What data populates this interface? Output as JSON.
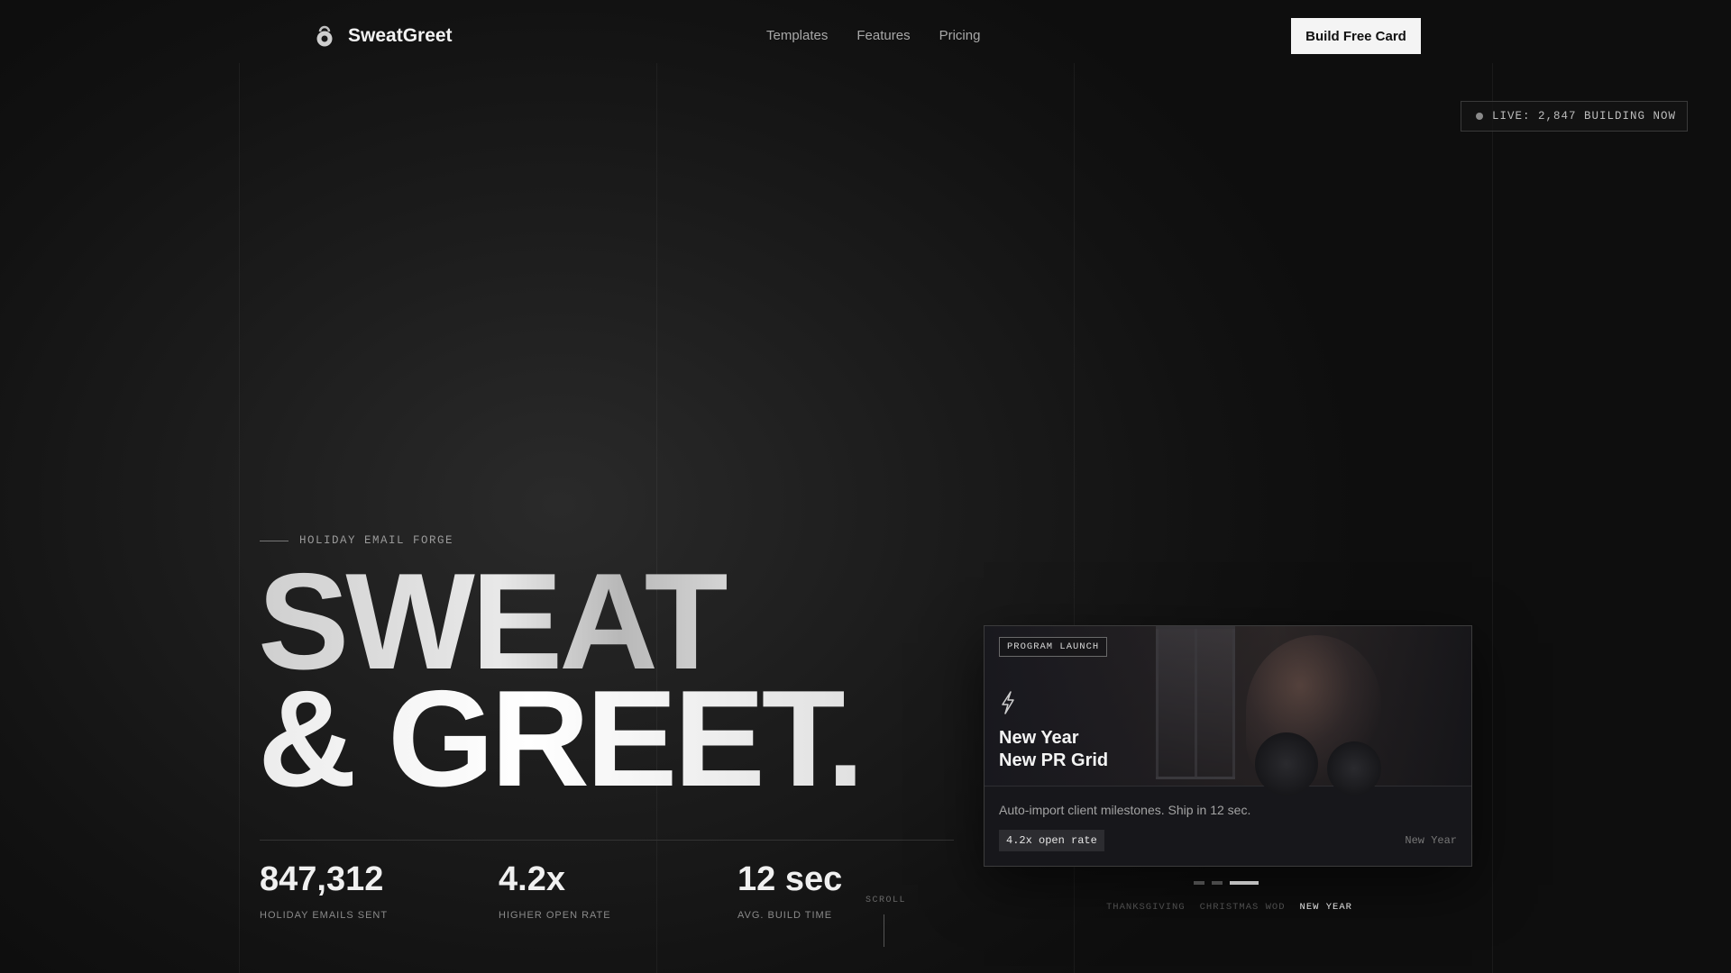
{
  "brand": {
    "name": "SweatGreet",
    "icon": "kettlebell-icon"
  },
  "nav": {
    "links": [
      "Templates",
      "Features",
      "Pricing"
    ],
    "cta": "Build Free Card"
  },
  "live_badge": {
    "text": "LIVE: 2,847 BUILDING NOW"
  },
  "hero": {
    "eyebrow": "HOLIDAY EMAIL FORGE",
    "line1": "SWEAT",
    "line2": "& GREET."
  },
  "stats": [
    {
      "value": "847,312",
      "label": "HOLIDAY EMAILS SENT"
    },
    {
      "value": "4.2x",
      "label": "HIGHER OPEN RATE"
    },
    {
      "value": "12 sec",
      "label": "AVG. BUILD TIME"
    }
  ],
  "scroll": {
    "text": "SCROLL"
  },
  "card": {
    "tag": "PROGRAM LAUNCH",
    "icon": "lightning-bolt-icon",
    "title_line1": "New Year",
    "title_line2": "New PR Grid",
    "description": "Auto-import client milestones. Ship in 12 sec.",
    "chip": "4.2x open rate",
    "season": "New Year"
  },
  "carousel": {
    "active_index": 2,
    "seasons": [
      "THANKSGIVING",
      "CHRISTMAS WOD",
      "NEW YEAR"
    ]
  },
  "colors": {
    "background": "#141414",
    "cta_bg": "#f4f4f4",
    "accent": "#ffffff"
  }
}
